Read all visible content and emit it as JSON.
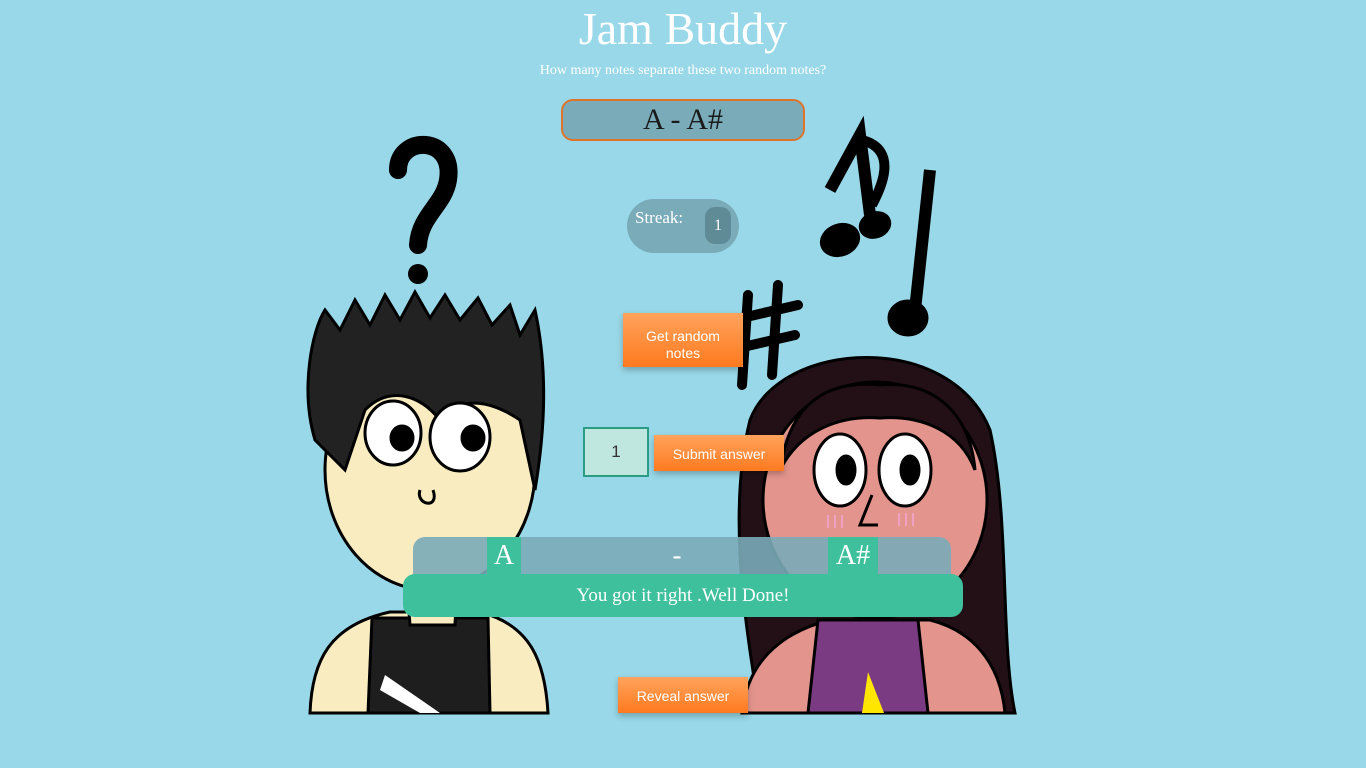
{
  "header": {
    "title": "Jam Buddy",
    "subtitle": "How many notes separate these two random notes?"
  },
  "notes": {
    "display": "A - A#",
    "first": "A",
    "second": "A#",
    "separator": "-"
  },
  "streak": {
    "label": "Streak:",
    "value": "1"
  },
  "controls": {
    "random_button": "Get random notes",
    "answer_value": "1",
    "submit_button": "Submit answer",
    "reveal_button": "Reveal answer"
  },
  "result": {
    "message": "You got it right .Well Done!"
  },
  "colors": {
    "background": "#99d8e8",
    "panel": "#7aabb8",
    "accent_orange": "#ff8a3d",
    "success_green": "#3fc09c"
  },
  "icons": [
    "question-mark-icon",
    "music-note-icon",
    "sharp-icon"
  ]
}
